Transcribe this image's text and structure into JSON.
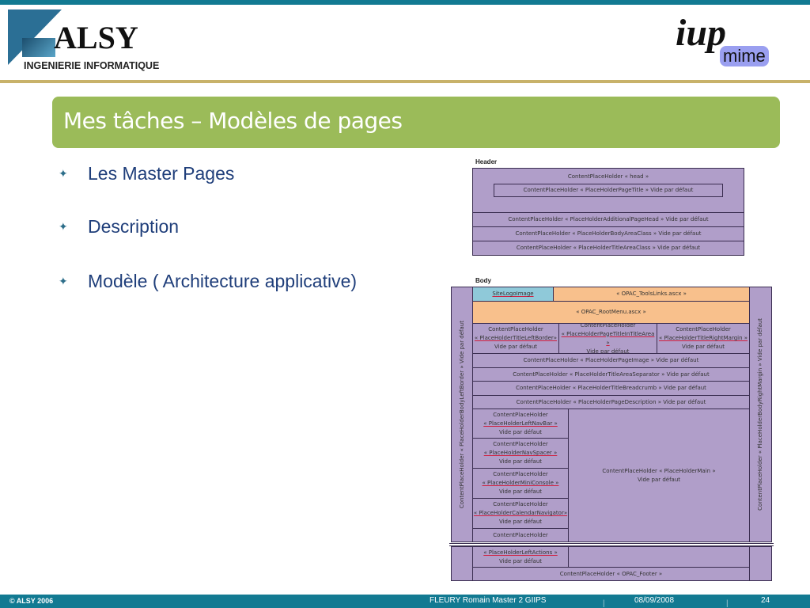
{
  "header": {
    "alsy_logo": {
      "name": "ALSY",
      "tagline": "INGENIERIE INFORMATIQUE"
    },
    "iup_logo": {
      "main": "iup",
      "sub": "mime"
    }
  },
  "title": "Mes tâches – Modèles de pages",
  "bullets": [
    "Les Master Pages",
    "Description",
    "Modèle ( Architecture applicative)"
  ],
  "diagram": {
    "header_label": "Header",
    "header_head": "ContentPlaceHolder « head »",
    "header_pagetitle": "ContentPlaceHolder « PlaceHolderPageTitle » Vide par défaut",
    "header_rows": [
      "ContentPlaceHolder « PlaceHolderAdditionalPageHead » Vide par défaut",
      "ContentPlaceHolder « PlaceHolderBodyAreaClass » Vide par défaut",
      "ContentPlaceHolder « PlaceHolderTitleAreaClass » Vide par défaut"
    ],
    "body_label": "Body",
    "left_border": "ContentPlaceHolder « PlaceHolderBodyLeftBorder » Vide par défaut",
    "right_margin": "ContentPlaceHolder « PlaceHolderBodyRightMargin » Vide par défaut",
    "site_logo": "SiteLogoImage",
    "tools_links": "« OPAC_ToolsLinks.ascx »",
    "root_menu": "« OPAC_RootMenu.ascx »",
    "title_cols": [
      {
        "a": "ContentPlaceHolder",
        "b": "« PlaceHolderTitleLeftBorder»",
        "c": "Vide par défaut"
      },
      {
        "a": "ContentPlaceHolder",
        "b": "« PlaceHolderPageTitleInTitleArea »",
        "c": "Vide par défaut"
      },
      {
        "a": "ContentPlaceHolder",
        "b": "« PlaceHolderTitleRightMargin »",
        "c": "Vide par défaut"
      }
    ],
    "body_rows": [
      "ContentPlaceHolder « PlaceHolderPageImage » Vide par défaut",
      "ContentPlaceHolder « PlaceHolderTitleAreaSeparator » Vide par défaut",
      "ContentPlaceHolder « PlaceHolderTitleBreadcrumb » Vide par défaut",
      "ContentPlaceHolder « PlaceHolderPageDescription » Vide par défaut"
    ],
    "left_nav": [
      {
        "a": "ContentPlaceHolder",
        "b": "« PlaceHolderLeftNavBar »",
        "c": "Vide par défaut"
      },
      {
        "a": "ContentPlaceHolder",
        "b": "« PlaceHolderNavSpacer »",
        "c": "Vide par défaut"
      },
      {
        "a": "ContentPlaceHolder",
        "b": "« PlaceHolderMiniConsole »",
        "c": "Vide par défaut"
      },
      {
        "a": "ContentPlaceHolder",
        "b": "« PlaceHolderCalendarNavigator»",
        "c": "Vide par défaut"
      }
    ],
    "left_actions_top": "ContentPlaceHolder",
    "left_actions": {
      "b": "« PlaceHolderLeftActions »",
      "c": "Vide par défaut"
    },
    "main": {
      "a": "ContentPlaceHolder « PlaceHolderMain »",
      "b": "Vide par défaut"
    },
    "footer": "ContentPlaceHolder « OPAC_Footer »"
  },
  "footer": {
    "copyright": "© ALSY 2006",
    "author": "FLEURY Romain Master 2 GIIPS",
    "date": "08/09/2008",
    "page": "24"
  }
}
